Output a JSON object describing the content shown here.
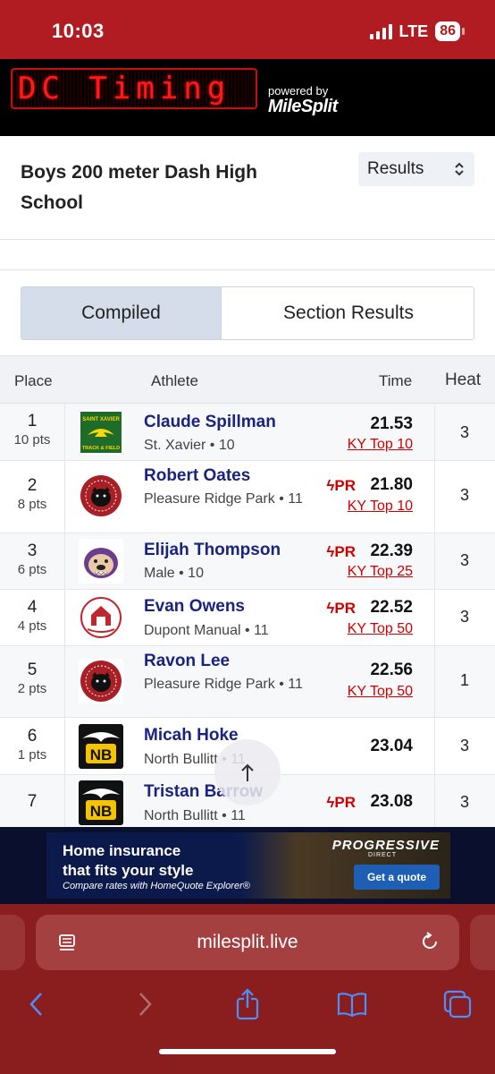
{
  "status": {
    "time": "10:03",
    "network": "LTE",
    "battery": "86"
  },
  "brand": {
    "logo_text": "DC Timing",
    "powered_by": "powered by",
    "partner": "MileSplit"
  },
  "event": {
    "title": "Boys 200 meter Dash High School",
    "view_select": "Results"
  },
  "tabs": [
    {
      "label": "Compiled",
      "active": true
    },
    {
      "label": "Section Results",
      "active": false
    }
  ],
  "table": {
    "headers": {
      "place": "Place",
      "athlete": "Athlete",
      "time": "Time",
      "heat": "Heat"
    },
    "rows": [
      {
        "place": "1",
        "pts": "10 pts",
        "name": "Claude Spillman",
        "team": "St. Xavier • 10",
        "pr": "",
        "time": "21.53",
        "rank": "KY Top 10",
        "heat": "3"
      },
      {
        "place": "2",
        "pts": "8 pts",
        "name": "Robert Oates",
        "team": "Pleasure Ridge Park • 11",
        "pr": "PR",
        "time": "21.80",
        "rank": "KY Top 10",
        "heat": "3"
      },
      {
        "place": "3",
        "pts": "6 pts",
        "name": "Elijah Thompson",
        "team": "Male • 10",
        "pr": "PR",
        "time": "22.39",
        "rank": "KY Top 25",
        "heat": "3"
      },
      {
        "place": "4",
        "pts": "4 pts",
        "name": "Evan Owens",
        "team": "Dupont Manual • 11",
        "pr": "PR",
        "time": "22.52",
        "rank": "KY Top 50",
        "heat": "3"
      },
      {
        "place": "5",
        "pts": "2 pts",
        "name": "Ravon Lee",
        "team": "Pleasure Ridge Park • 11",
        "pr": "",
        "time": "22.56",
        "rank": "KY Top 50",
        "heat": "1"
      },
      {
        "place": "6",
        "pts": "1 pts",
        "name": "Micah Hoke",
        "team": "North Bullitt • 11",
        "pr": "",
        "time": "23.04",
        "rank": "",
        "heat": "3"
      },
      {
        "place": "7",
        "pts": "",
        "name": "Tristan Barrow",
        "team": "North Bullitt • 11",
        "pr": "PR",
        "time": "23.08",
        "rank": "",
        "heat": "3"
      }
    ]
  },
  "logos": {
    "st_xavier_top": "SAINT XAVIER",
    "st_xavier_bottom": "TRACK & FIELD",
    "north_bullitt": "NB"
  },
  "ad": {
    "headline_1": "Home insurance",
    "headline_2": "that fits your style",
    "subline": "Compare rates with HomeQuote Explorer®",
    "brand": "PROGRESSIVE",
    "brand_sub": "DIRECT",
    "cta": "Get a quote"
  },
  "browser": {
    "url": "milesplit.live"
  },
  "colors": {
    "primary": "#b01c21",
    "athlete_link": "#1a237e",
    "pr_red": "#d00000",
    "tab_active": "#d5dcea",
    "browser_chrome": "#8a1d1d"
  }
}
